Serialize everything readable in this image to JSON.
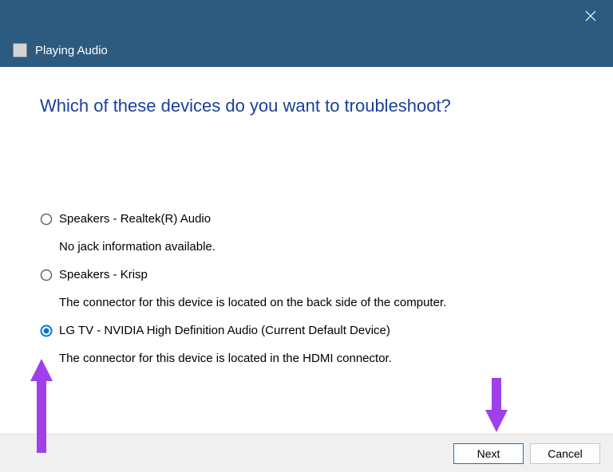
{
  "window": {
    "title": "Playing Audio"
  },
  "heading": "Which of these devices do you want to troubleshoot?",
  "options": [
    {
      "label": "Speakers - Realtek(R) Audio",
      "detail": "No jack information available.",
      "selected": false
    },
    {
      "label": "Speakers - Krisp",
      "detail": "The connector for this device is located on the back side of the computer.",
      "selected": false
    },
    {
      "label": "LG TV - NVIDIA High Definition Audio (Current Default Device)",
      "detail": "The connector for this device is located in the HDMI connector.",
      "selected": true
    }
  ],
  "buttons": {
    "next": "Next",
    "cancel": "Cancel"
  }
}
